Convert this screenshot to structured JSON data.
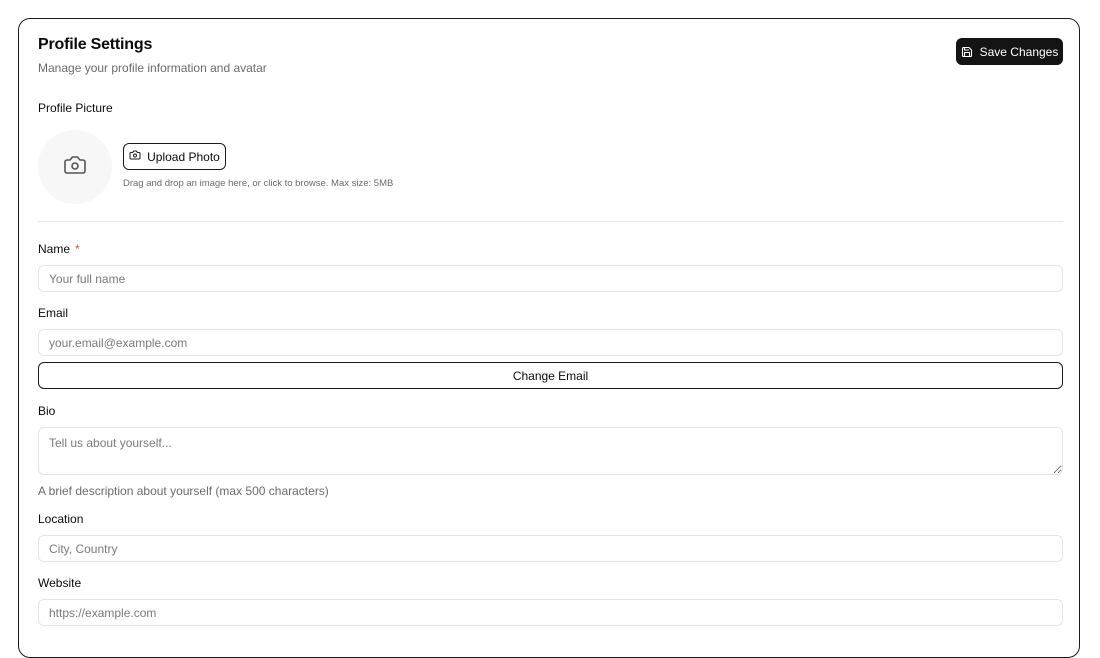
{
  "header": {
    "title": "Profile Settings",
    "subtitle": "Manage your profile information and avatar",
    "save_label": "Save Changes"
  },
  "avatar_section": {
    "label": "Profile Picture",
    "upload_label": "Upload Photo",
    "hint": "Drag and drop an image here, or click to browse. Max size: 5MB"
  },
  "form": {
    "name": {
      "label": "Name",
      "required_mark": "*",
      "value": "",
      "placeholder": "Your full name"
    },
    "email": {
      "label": "Email",
      "value": "",
      "placeholder": "your.email@example.com",
      "change_label": "Change Email"
    },
    "bio": {
      "label": "Bio",
      "value": "",
      "placeholder": "Tell us about yourself...",
      "helper": "A brief description about yourself (max 500 characters)"
    },
    "location": {
      "label": "Location",
      "value": "",
      "placeholder": "City, Country"
    },
    "website": {
      "label": "Website",
      "value": "",
      "placeholder": "https://example.com"
    }
  },
  "icons": {
    "save": "save-icon",
    "camera": "camera-icon"
  },
  "colors": {
    "primary": "#141414",
    "required": "#e5484d",
    "muted_text": "#6b6b6b",
    "border": "#e4e4e4"
  }
}
